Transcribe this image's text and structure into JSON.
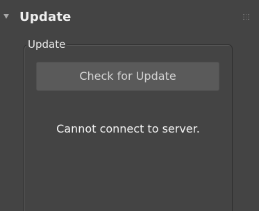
{
  "rollout": {
    "title": "Update"
  },
  "group": {
    "label": "Update"
  },
  "buttons": {
    "check_update": "Check for Update"
  },
  "status": {
    "message": "Cannot connect to server."
  },
  "icons": {
    "collapse": "triangle-down-icon",
    "grip": "drag-grip-icon"
  },
  "colors": {
    "panel_bg": "#444444",
    "button_bg": "#5a5a5a",
    "text": "#f0f0f0"
  }
}
